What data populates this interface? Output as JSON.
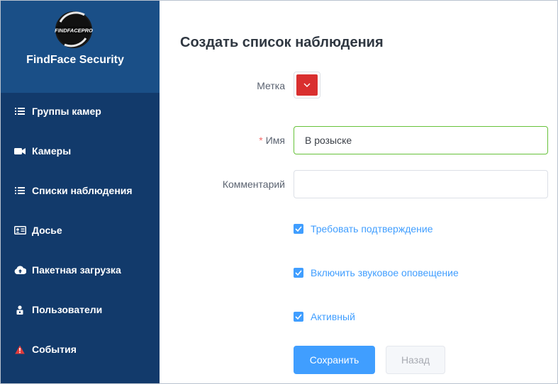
{
  "sidebar": {
    "brand_logo_text": "FINDFACEPRO",
    "brand_title": "FindFace Security",
    "items": [
      {
        "label": "Группы камер",
        "icon": "list-icon"
      },
      {
        "label": "Камеры",
        "icon": "video-camera-icon"
      },
      {
        "label": "Списки наблюдения",
        "icon": "list-icon"
      },
      {
        "label": "Досье",
        "icon": "id-card-icon"
      },
      {
        "label": "Пакетная загрузка",
        "icon": "cloud-upload-icon"
      },
      {
        "label": "Пользователи",
        "icon": "user-lock-icon"
      },
      {
        "label": "События",
        "icon": "warning-icon"
      }
    ]
  },
  "form": {
    "title": "Создать список наблюдения",
    "color_label": "Метка",
    "color_value": "#d92f2f",
    "name_required_mark": "*",
    "name_label": "Имя",
    "name_value": "В розыске",
    "comment_label": "Комментарий",
    "comment_value": "",
    "checkboxes": [
      {
        "label": "Требовать подтверждение",
        "checked": true
      },
      {
        "label": "Включить звуковое оповещение",
        "checked": true
      },
      {
        "label": "Активный",
        "checked": true
      }
    ],
    "save_label": "Сохранить",
    "back_label": "Назад"
  },
  "colors": {
    "sidebar_bg": "#123a6b",
    "brand_bg": "#1a4f87",
    "accent": "#409eff",
    "valid": "#67c23a",
    "warning": "#e03b3b"
  }
}
